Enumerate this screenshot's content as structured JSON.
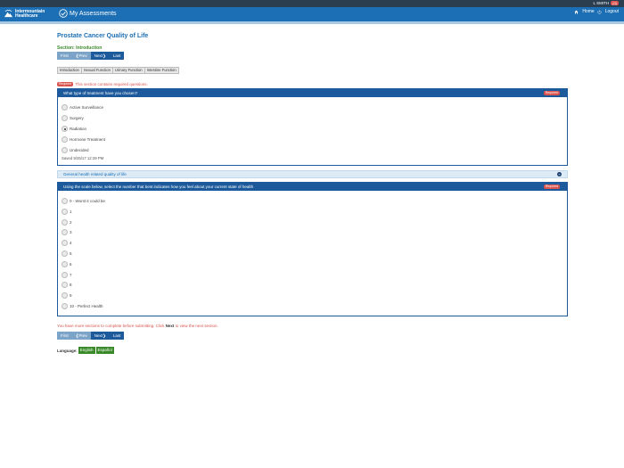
{
  "user": {
    "name": "L SMITH",
    "count": "(0)"
  },
  "header": {
    "logo_line1": "Intermountain",
    "logo_line2": "Healthcare",
    "app_name": "My Assessments",
    "home_label": "Home",
    "logout_label": "Logout"
  },
  "page": {
    "title": "Prostate Cancer Quality of Life",
    "section": "Section: Introduction"
  },
  "pager": {
    "first": "First",
    "prev": "Prev",
    "next": "Next",
    "last": "Last"
  },
  "tabs": [
    "Introduction",
    "Sexual Function",
    "Urinary Function",
    "Intestine Function"
  ],
  "required_note": {
    "badge": "Required",
    "text": "This section contains required questions."
  },
  "question1": {
    "title": "What type of treatment have you chosen?",
    "badge": "Required",
    "options": [
      "Active Surveillance",
      "Surgery",
      "Radiation",
      "Hormone Treatment",
      "Undecided"
    ],
    "selected_index": 2,
    "saved": "Saved 9/25/17 12:29 PM"
  },
  "collapsed_section": {
    "title": "General health related quality of life"
  },
  "question2": {
    "title": "Using the scale below, select the number that best indicates how you feel about your current state of health",
    "badge": "Required",
    "options": [
      "0 - Worst it could be",
      "1",
      "2",
      "3",
      "4",
      "5",
      "6",
      "7",
      "8",
      "9",
      "10 - Perfect Health"
    ]
  },
  "more_note": {
    "before": "You have more sections to complete before submitting. Click ",
    "bold": "Next",
    "after": " to view the next section."
  },
  "language": {
    "label": "Language:",
    "english": "English",
    "espanol": "Español"
  },
  "colors": {
    "brand_blue": "#1c6fb5",
    "panel_blue": "#1c5a9c",
    "required_red": "#d9534f",
    "green": "#3a8a2a"
  }
}
